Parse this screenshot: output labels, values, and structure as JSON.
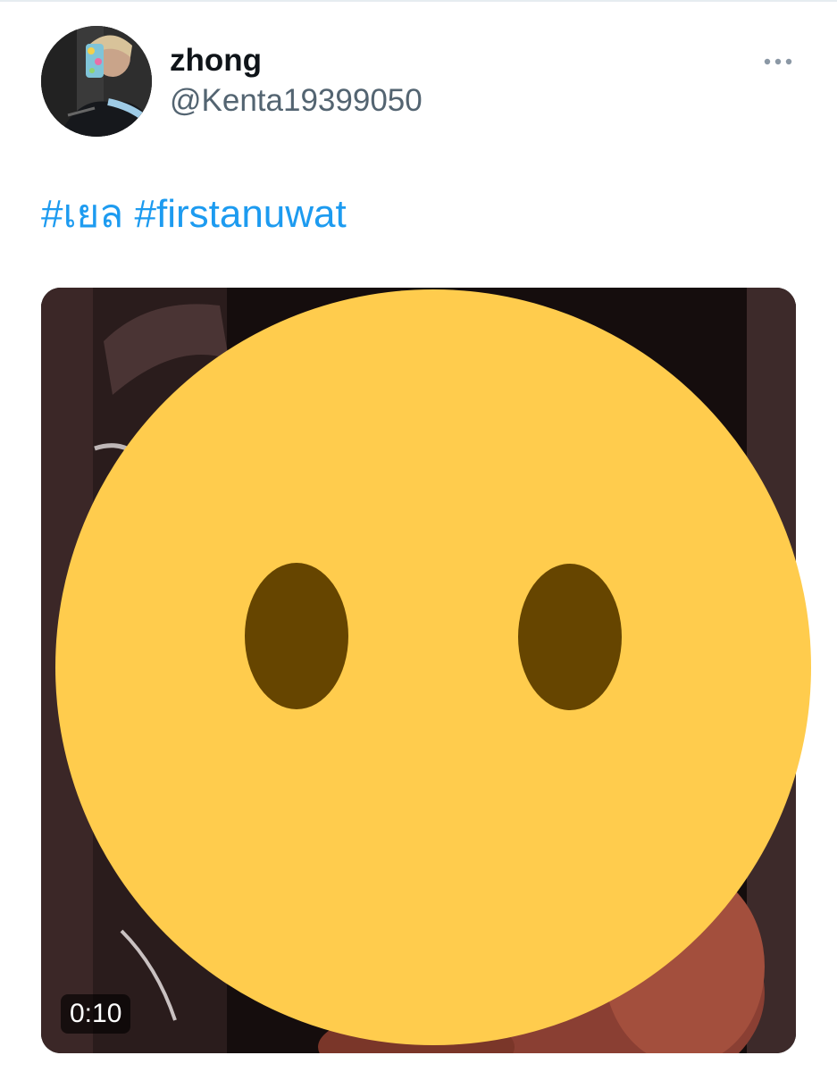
{
  "author": {
    "display_name": "zhong",
    "handle": "@Kenta19399050"
  },
  "tweet": {
    "hashtags": [
      "#เยล",
      "#firstanuwat"
    ]
  },
  "media": {
    "type": "video",
    "duration": "0:10"
  },
  "icons": {
    "more": "more-horizontal-icon",
    "overlay": "face-without-mouth-emoji"
  },
  "colors": {
    "link": "#1d9bf0",
    "name": "#0f1419",
    "secondary": "#536471",
    "emoji_face": "#ffcc4d",
    "emoji_eyes": "#664500"
  }
}
